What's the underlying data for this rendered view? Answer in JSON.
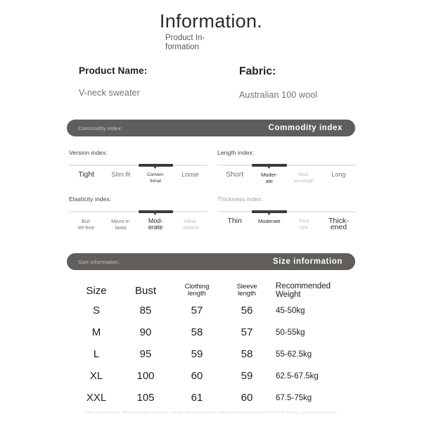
{
  "header": {
    "title": "Information.",
    "subtitle_line1": "Product In-",
    "subtitle_line2": "formation"
  },
  "product": {
    "name_label": "Product Name:",
    "name_value": "V-neck sweater",
    "fabric_label": "Fabric:",
    "fabric_value": "Australian 100 wool"
  },
  "commodity_banner": {
    "left_label": "Commodity index:",
    "right_label": "Commodity index"
  },
  "size_banner": {
    "left_label": "Size information:",
    "right_label": "Size information"
  },
  "indexes": [
    {
      "title": "Version index:",
      "selected": 2,
      "options": [
        "Tight",
        "Slim fit",
        "Conven-\ntional",
        "Loose"
      ]
    },
    {
      "title": "Length index:",
      "selected": 1,
      "options": [
        "Short",
        "Moder-\nate",
        "Medi-\num-length",
        "Long"
      ]
    },
    {
      "title": "Elasticity index:",
      "selected": 2,
      "options": [
        "Bul-\nlet-free",
        "Micro-e-\nlastic",
        "Mod-\nerate",
        "Ultra-\n-stretch"
      ]
    },
    {
      "title": "Thickness index:",
      "selected": 1,
      "options": [
        "Thin",
        "Moderate",
        "Thick\ntype",
        "Thick-\nened"
      ]
    }
  ],
  "size_table": {
    "headers": {
      "size": "Size",
      "bust": "Bust",
      "clothing_length_l1": "Clothing",
      "clothing_length_l2": "length",
      "sleeve_length_l1": "Sleeve",
      "sleeve_length_l2": "length",
      "recommended_weight_l1": "Recommended",
      "recommended_weight_l2": "Weight"
    },
    "rows": [
      {
        "size": "S",
        "bust": "85",
        "clothing": "57",
        "sleeve": "56",
        "weight": "45-50kg"
      },
      {
        "size": "M",
        "bust": "90",
        "clothing": "58",
        "sleeve": "57",
        "weight": "50-55kg"
      },
      {
        "size": "L",
        "bust": "95",
        "clothing": "59",
        "sleeve": "58",
        "weight": "55-62.5kg"
      },
      {
        "size": "XL",
        "bust": "100",
        "clothing": "60",
        "sleeve": "59",
        "weight": "62.5-67.5kg"
      },
      {
        "size": "XXL",
        "bust": "105",
        "clothing": "61",
        "sleeve": "60",
        "weight": "67.5-75kg"
      }
    ]
  },
  "footer": {
    "disclaimer": "Every item of dress different design materials, we use tile measurement, manual measurement will have 2-4CM error, please understand."
  },
  "colors": {
    "banner_bg": "#605d5a",
    "banner_text": "#ffffff",
    "track": "#e6e6e6",
    "track_active": "#3a3a3a",
    "text_primary": "#1d1f20",
    "text_muted": "#8d9296"
  }
}
